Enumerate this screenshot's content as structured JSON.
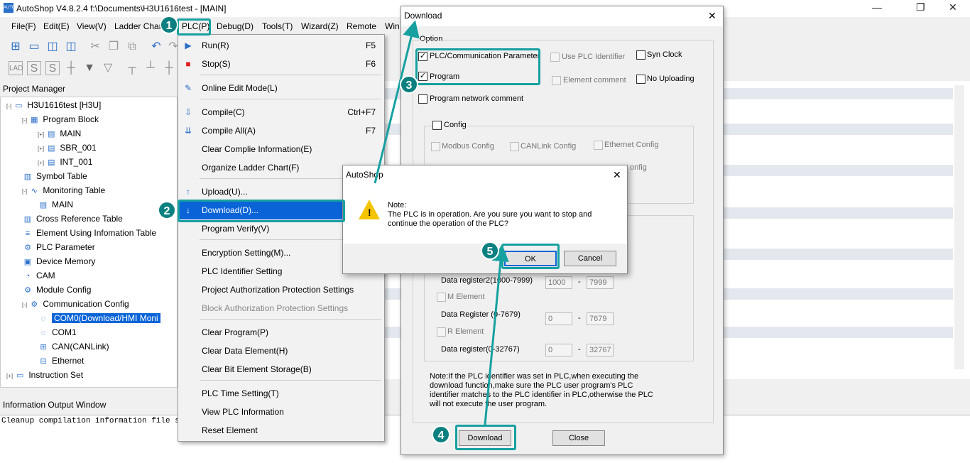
{
  "window": {
    "title": "AutoShop V4.8.2.4  f:\\Documents\\H3U1616test - [MAIN]",
    "logo_text": "AUTO"
  },
  "menubar": [
    "File(F)",
    "Edit(E)",
    "View(V)",
    "Ladder Chart",
    "PLC(P)",
    "Debug(D)",
    "Tools(T)",
    "Wizard(Z)",
    "Remote",
    "Win"
  ],
  "project_manager": {
    "title": "Project Manager",
    "items": [
      {
        "label": "H3U1616test [H3U]",
        "icon": "computer-icon",
        "exp": "-"
      },
      {
        "label": "Program Block",
        "icon": "blocks-icon",
        "exp": "-"
      },
      {
        "label": "MAIN",
        "icon": "page-icon",
        "exp": "+"
      },
      {
        "label": "SBR_001",
        "icon": "page-icon",
        "exp": "+"
      },
      {
        "label": "INT_001",
        "icon": "page-icon",
        "exp": "+"
      },
      {
        "label": "Symbol Table",
        "icon": "table-icon",
        "exp": ""
      },
      {
        "label": "Monitoring Table",
        "icon": "wave-icon",
        "exp": "-"
      },
      {
        "label": "MAIN",
        "icon": "page-icon",
        "exp": ""
      },
      {
        "label": "Cross Reference Table",
        "icon": "table-icon",
        "exp": ""
      },
      {
        "label": "Element Using Infomation Table",
        "icon": "db-icon",
        "exp": ""
      },
      {
        "label": "PLC Parameter",
        "icon": "gear-icon",
        "exp": ""
      },
      {
        "label": "Device Memory",
        "icon": "memory-icon",
        "exp": ""
      },
      {
        "label": "CAM",
        "icon": "cam-icon",
        "exp": ""
      },
      {
        "label": "Module Config",
        "icon": "module-icon",
        "exp": ""
      },
      {
        "label": "Communication Config",
        "icon": "comm-icon",
        "exp": "-"
      },
      {
        "label": "COM0(Download/HMI Moni",
        "icon": "port-icon",
        "exp": ""
      },
      {
        "label": "COM1",
        "icon": "port-icon",
        "exp": ""
      },
      {
        "label": "CAN(CANLink)",
        "icon": "network-icon",
        "exp": ""
      },
      {
        "label": "Ethernet",
        "icon": "ethernet-icon",
        "exp": ""
      },
      {
        "label": "Instruction Set",
        "icon": "computer-icon",
        "exp": "+"
      }
    ]
  },
  "info_output": {
    "title": "Information Output Window",
    "text": "Cleanup compilation information file succ"
  },
  "plc_menu": {
    "items": [
      {
        "label": "Run(R)",
        "shortcut": "F5",
        "icon": "run-icon",
        "glyph": "▶"
      },
      {
        "label": "Stop(S)",
        "shortcut": "F6",
        "icon": "stop-icon",
        "glyph": "■"
      },
      {
        "label": "Online Edit Mode(L)",
        "shortcut": "",
        "icon": "edit-icon",
        "glyph": "✎"
      },
      {
        "label": "Compile(C)",
        "shortcut": "Ctrl+F7",
        "icon": "compile-icon",
        "glyph": "⇩"
      },
      {
        "label": "Compile All(A)",
        "shortcut": "F7",
        "icon": "compile-all-icon",
        "glyph": "⇊"
      },
      {
        "label": "Clear Complie Information(E)",
        "shortcut": "",
        "icon": "",
        "glyph": ""
      },
      {
        "label": "Organize Ladder Chart(F)",
        "shortcut": "",
        "icon": "",
        "glyph": ""
      },
      {
        "label": "Upload(U)...",
        "shortcut": "",
        "icon": "upload-icon",
        "glyph": "↑"
      },
      {
        "label": "Download(D)...",
        "shortcut": "",
        "icon": "download-icon",
        "glyph": "↓"
      },
      {
        "label": "Program Verify(V)",
        "shortcut": "",
        "icon": "",
        "glyph": ""
      },
      {
        "label": "Encryption Setting(M)...",
        "shortcut": "",
        "icon": "",
        "glyph": ""
      },
      {
        "label": "PLC Identifier Setting",
        "shortcut": "",
        "icon": "",
        "glyph": ""
      },
      {
        "label": "Project Authorization Protection Settings",
        "shortcut": "",
        "icon": "",
        "glyph": ""
      },
      {
        "label": "Block Authorization Protection Settings",
        "shortcut": "",
        "icon": "",
        "glyph": "",
        "disabled": true
      },
      {
        "label": "Clear Program(P)",
        "shortcut": "",
        "icon": "",
        "glyph": ""
      },
      {
        "label": "Clear Data Element(H)",
        "shortcut": "",
        "icon": "",
        "glyph": ""
      },
      {
        "label": "Clear Bit Element Storage(B)",
        "shortcut": "",
        "icon": "",
        "glyph": ""
      },
      {
        "label": "PLC Time Setting(T)",
        "shortcut": "",
        "icon": "",
        "glyph": ""
      },
      {
        "label": "View PLC Information",
        "shortcut": "",
        "icon": "",
        "glyph": ""
      },
      {
        "label": "Reset Element",
        "shortcut": "",
        "icon": "",
        "glyph": ""
      }
    ]
  },
  "download_dialog": {
    "title": "Download",
    "option_label": "Option",
    "plc_comm_param": "PLC/Communication Parameter",
    "use_plc_identifier": "Use PLC Identifier",
    "syn_clock": "Syn Clock",
    "program": "Program",
    "element_comment": "Element comment",
    "no_uploading": "No Uploading",
    "program_network_comment": "Program network comment",
    "config": "Config",
    "modbus_config": "Modbus Config",
    "canlink_config": "CANLink Config",
    "ethernet_config": "Ethernet Config",
    "partial_config": "onfig",
    "data_register2": "Data register2(1000-7999)",
    "dr2_from": "1000",
    "dr2_to": "7999",
    "m_element": "M Element",
    "data_register_m": "Data Register (0-7679)",
    "m_from": "0",
    "m_to": "7679",
    "r_element": "R Element",
    "data_register_r": "Data register(0-32767)",
    "r_from": "0",
    "r_to": "32767",
    "dash": "-",
    "note": "Note:If the PLC identifier was set in PLC,when executing the download function,make sure the PLC user program's PLC identifier matches to the PLC identifier in PLC,otherwise the PLC will not execute the user program.",
    "download_btn": "Download",
    "close_btn": "Close"
  },
  "alert": {
    "title": "AutoShop",
    "note": "Note:",
    "message": "The PLC is in operation. Are you sure you want to stop and continue the operation of the PLC?",
    "ok": "OK",
    "cancel": "Cancel"
  },
  "annotations": [
    "1",
    "2",
    "3",
    "4",
    "5"
  ],
  "colors": {
    "accent": "#0a64d8",
    "annotation": "#17a0a0"
  }
}
